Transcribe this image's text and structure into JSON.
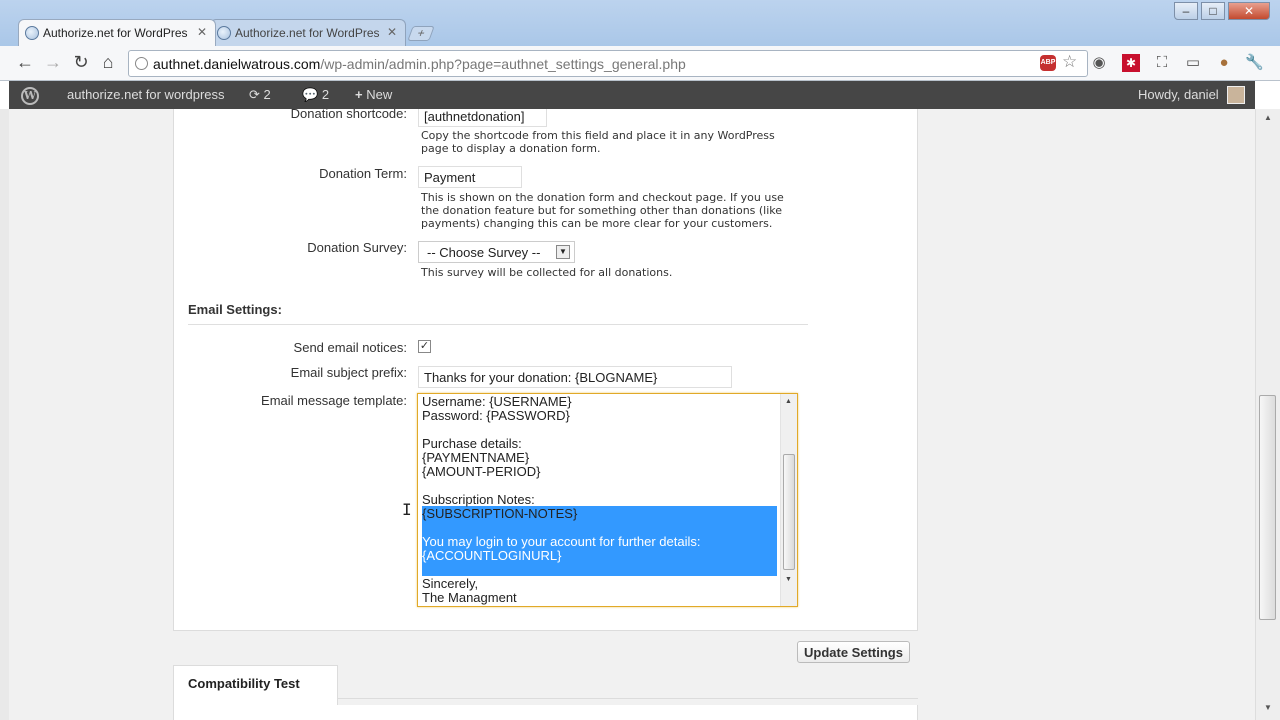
{
  "browser": {
    "tabs": [
      {
        "label": "Authorize.net for WordPres"
      },
      {
        "label": "Authorize.net for WordPres"
      }
    ],
    "url_host": "authnet.danielwatrous.com",
    "url_path": "/wp-admin/admin.php?page=authnet_settings_general.php",
    "abp_label": "ABP",
    "window_buttons": {
      "min": "–",
      "max": "□",
      "close": "✕"
    }
  },
  "admin_bar": {
    "site_name": "authorize.net for wordpress",
    "updates_count": "2",
    "comments_count": "2",
    "new_label": "New",
    "howdy": "Howdy, daniel"
  },
  "form": {
    "shortcode_label": "Donation shortcode:",
    "shortcode_value": "[authnetdonation]",
    "shortcode_desc_1": "Copy the shortcode from this field and place it in any WordPress",
    "shortcode_desc_2": "page to display a donation form.",
    "term_label": "Donation Term:",
    "term_value": "Payment",
    "term_desc_1": "This is shown on the donation form and checkout page. If you use",
    "term_desc_2": "the donation feature but for something other than donations (like",
    "term_desc_3": "payments) changing this can be more clear for your customers.",
    "survey_label": "Donation Survey:",
    "survey_value": "-- Choose Survey --",
    "survey_desc": "This survey will be collected for all donations.",
    "email_section_title": "Email Settings:",
    "send_notices_label": "Send email notices:",
    "send_notices_checked": "✓",
    "subject_prefix_label": "Email subject prefix:",
    "subject_prefix_value": "Thanks for your donation: {BLOGNAME}",
    "template_label": "Email message template:",
    "template_lines": [
      "Username: {USERNAME}",
      "Password: {PASSWORD}",
      "",
      "Purchase details:",
      "{PAYMENTNAME}",
      "{AMOUNT-PERIOD}",
      "",
      "Subscription Notes:",
      "{SUBSCRIPTION-NOTES}",
      "",
      "You may login to your account for further details:",
      "{ACCOUNTLOGINURL}",
      "",
      "Sincerely,",
      "The Managment"
    ],
    "update_button": "Update Settings"
  },
  "compat_tab": "Compatibility Test"
}
